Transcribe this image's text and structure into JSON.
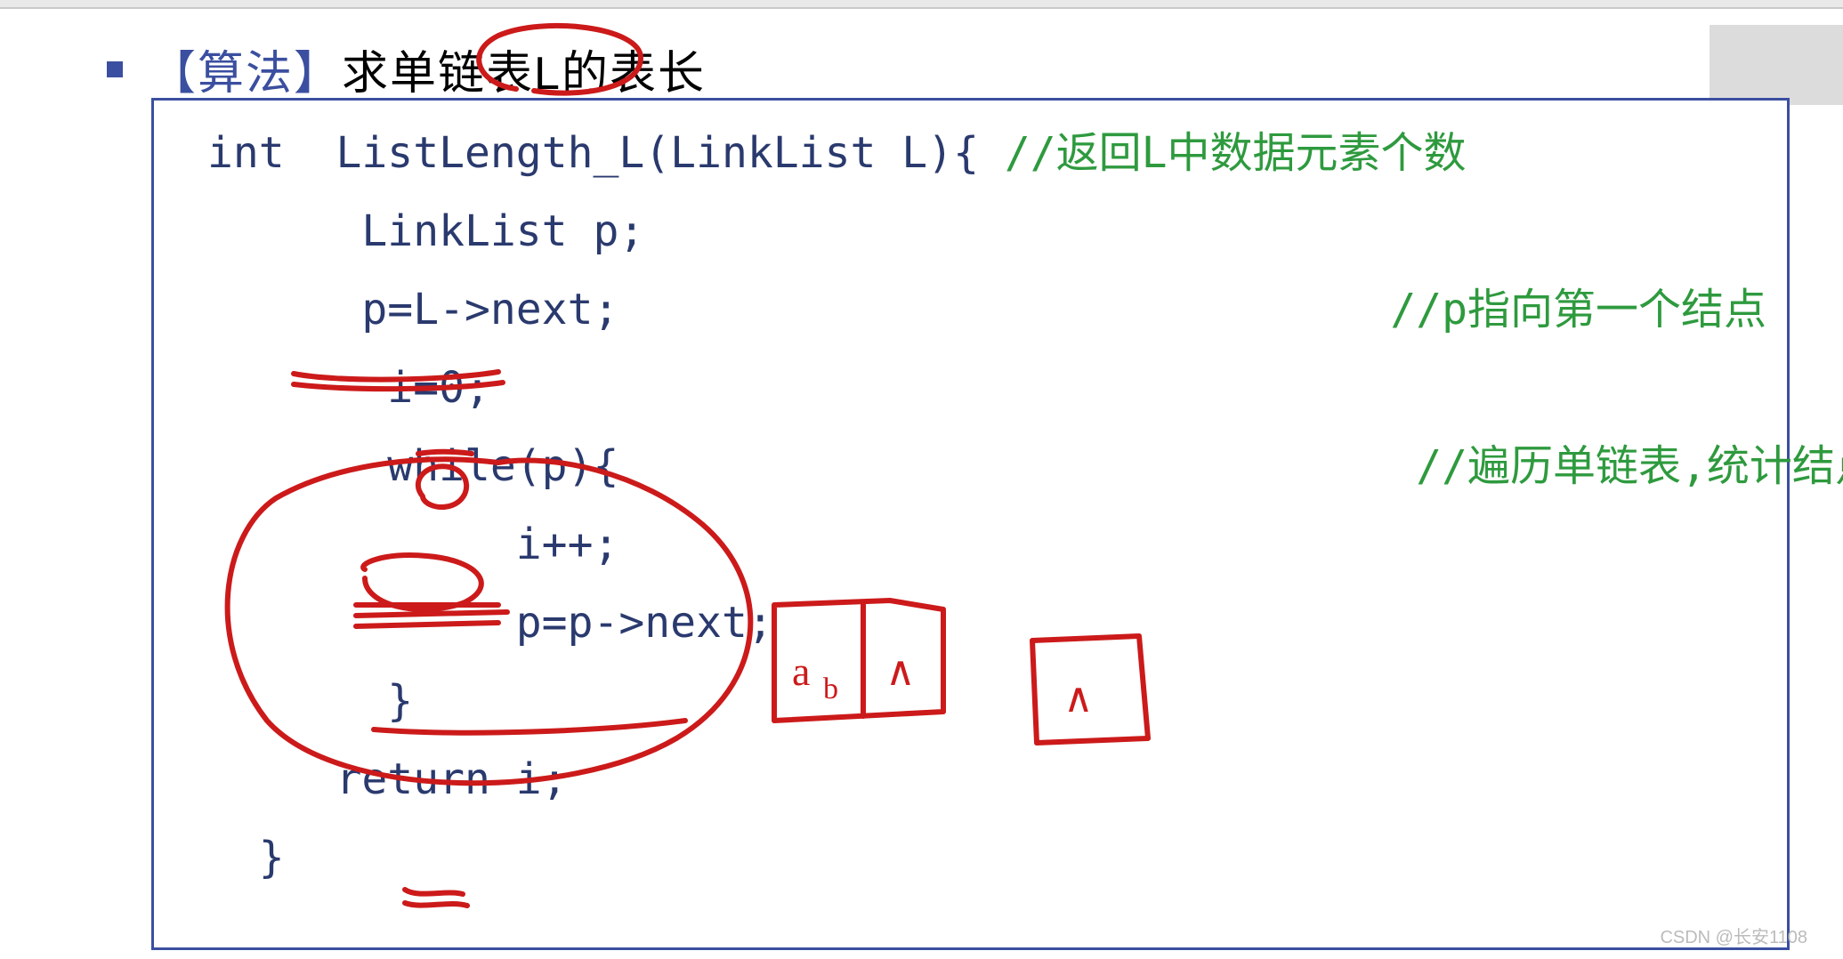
{
  "title": {
    "bracket_open": "【",
    "algorithm": "算法",
    "bracket_close": "】",
    "rest": "求单链表L的表长"
  },
  "code": {
    "line1": {
      "kw": "int",
      "name": "  ListLength_L(LinkList L){ ",
      "comment": "//返回L中数据元素个数"
    },
    "line2": "      LinkList p;",
    "line3": {
      "text": "      p=L->next;                              ",
      "comment": "//p指向第一个结点"
    },
    "line4": "       i=0;",
    "line5": {
      "text": "       while(p){                               ",
      "comment": "//遍历单链表,统计结点数"
    },
    "line6": "            i++;",
    "line7": "            p=p->next;",
    "line8": "       }",
    "line9": "     return i;",
    "line10": "  }"
  },
  "watermark": "CSDN @长安1108"
}
